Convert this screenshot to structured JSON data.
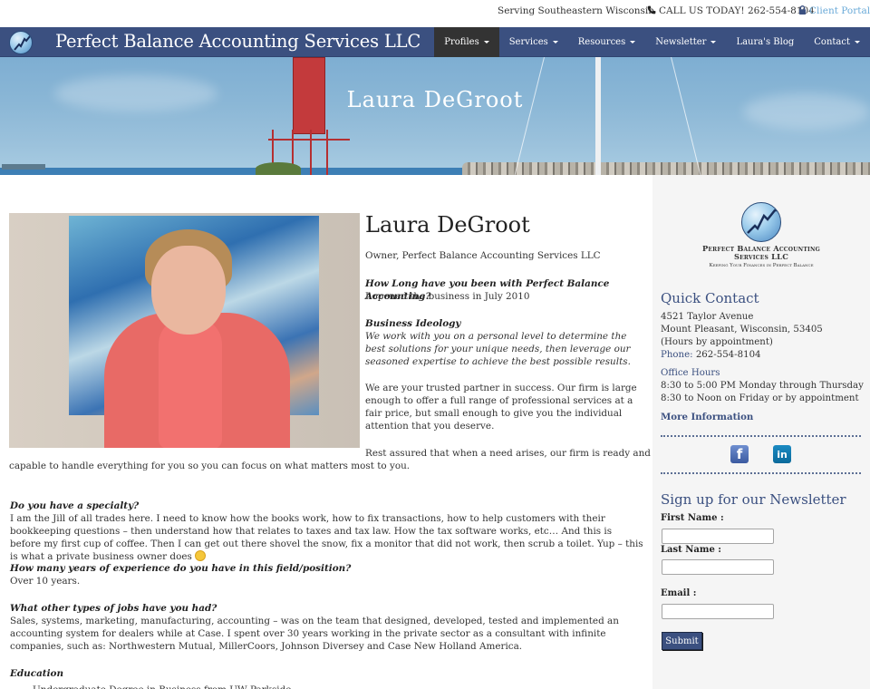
{
  "topbar": {
    "serving": "Serving Southeastern Wisconsin",
    "call": "CALL US TODAY! 262-554-8104",
    "portal": "Client Portal"
  },
  "navbar": {
    "brand": "Perfect Balance Accounting Services LLC",
    "items": [
      {
        "label": "Profiles",
        "dropdown": true,
        "active": true
      },
      {
        "label": "Services",
        "dropdown": true
      },
      {
        "label": "Resources",
        "dropdown": true
      },
      {
        "label": "Newsletter",
        "dropdown": true
      },
      {
        "label": "Laura's Blog",
        "dropdown": false
      },
      {
        "label": "Contact",
        "dropdown": true
      }
    ]
  },
  "hero": {
    "title": "Laura DeGroot"
  },
  "profile": {
    "name": "Laura DeGroot",
    "role": "Owner, Perfect Balance Accounting Services LLC",
    "q1": "How Long have you been with Perfect Balance Accounting?",
    "a1": "I opened the business in July 2010",
    "ideology_title": "Business Ideology",
    "ideology": "We work with you on a personal level to determine the best solutions for your unique needs, then leverage our seasoned expertise to achieve the best possible results.",
    "partner": "We are your trusted partner in success. Our firm is large enough to offer a full range of professional services at a fair price, but small enough to give you the individual attention that you deserve.",
    "rest_1": "Rest assured that when a need arises, our firm is ready and",
    "rest_2": "capable to handle everything for you so you can focus on what matters most to you.",
    "q2": "Do you have a specialty?",
    "a2": "I am the Jill of all trades here. I need to know how the books work, how to fix transactions, how to help customers with their bookkeeping questions – then understand how that relates to taxes and tax law. How the tax software works, etc… And this is before my first cup of coffee. Then I can get out there shovel the snow, fix a monitor that did not work, then scrub a toilet.  Yup – this is what a private business owner does",
    "q3": "How many years of experience do you have in this field/position?",
    "a3": "Over 10  years.",
    "q4": "What other types of jobs have you had?",
    "a4": "Sales, systems, marketing, manufacturing, accounting – was on the team that designed, developed, tested and implemented an accounting system for dealers while at Case. I spent over 30 years working in the private sector as a consultant with infinite companies, such as: Northwestern Mutual, MillerCoors, Johnson Diversey and Case New Holland America.",
    "q5": "Education",
    "a5": "Undergraduate Degree in Business from UW Parkside"
  },
  "sidebar": {
    "logo_name": "Perfect Balance Accounting Services LLC",
    "logo_tagline": "Keeping Your Finances in Perfect Balance",
    "quick_contact_title": "Quick Contact",
    "address1": "4521 Taylor Avenue",
    "address2": "Mount Pleasant, Wisconsin, 53405",
    "hours_note": "(Hours by appointment)",
    "phone_label": "Phone:",
    "phone": "262-554-8104",
    "office_hours_title": "Office Hours",
    "hours1": "8:30 to 5:00 PM Monday through Thursday",
    "hours2": "8:30 to Noon on Friday or by appointment",
    "more_info": "More Information",
    "social": [
      {
        "name": "facebook",
        "glyph": "f"
      },
      {
        "name": "linkedin",
        "glyph": "in"
      }
    ],
    "newsletter": {
      "title": "Sign up for our Newsletter",
      "first_name_label": "First Name :",
      "first_name_value": "",
      "last_name_label": "Last Name :",
      "last_name_value": "",
      "email_label": "Email :",
      "email_value": "",
      "submit_label": "Submit"
    }
  },
  "colors": {
    "nav_bg": "#3b5080",
    "nav_active": "#333333",
    "accent": "#3b5080",
    "portal_link": "#6aaad8",
    "sidebar_bg": "#f5f5f5"
  }
}
